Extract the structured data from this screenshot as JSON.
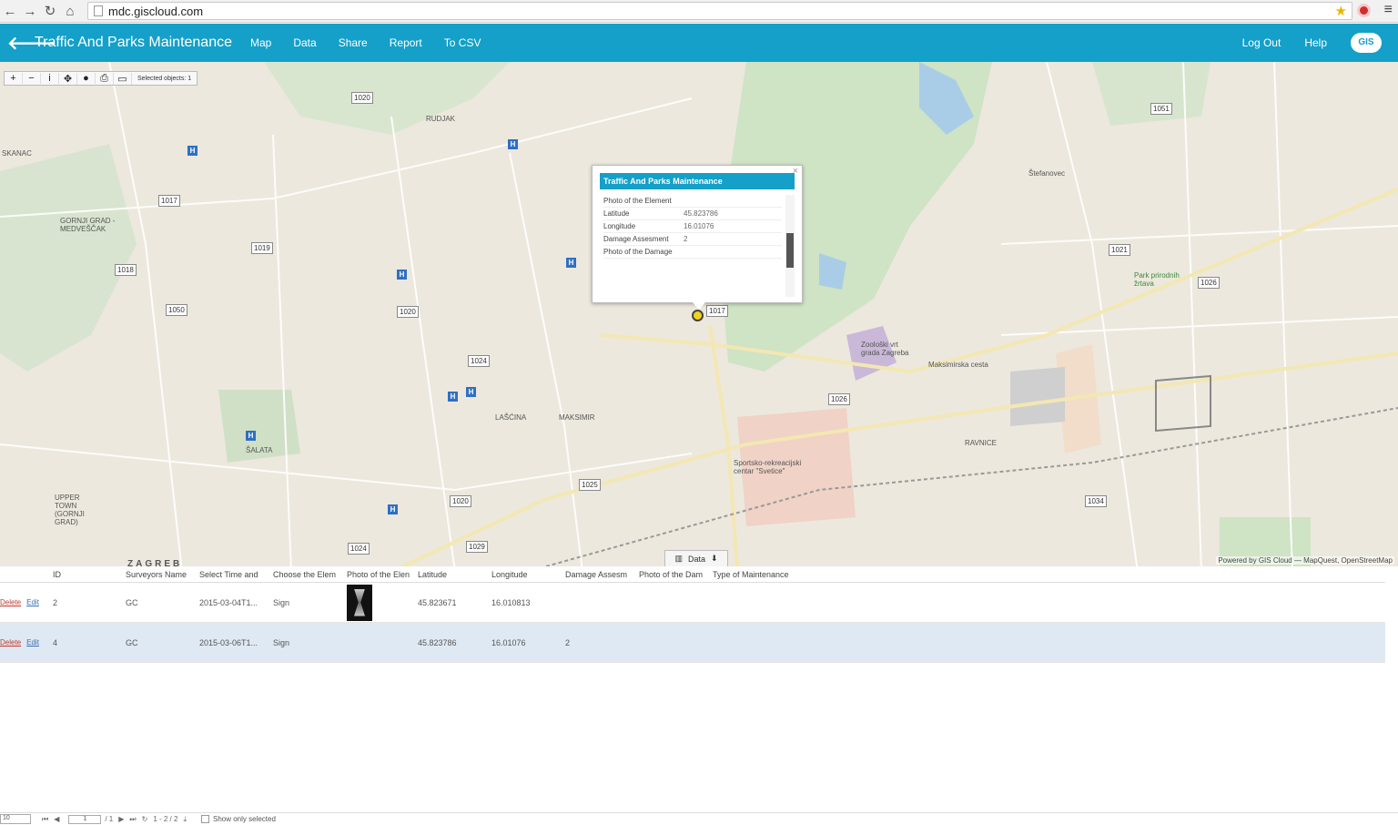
{
  "browser": {
    "url": "mdc.giscloud.com",
    "nav": {
      "back": "←",
      "forward": "→",
      "reload": "↻",
      "home": "⌂"
    },
    "icons": [
      "star-icon",
      "opera-icon",
      "menu-icon"
    ]
  },
  "header": {
    "title": "Traffic And Parks Maintenance",
    "menu": [
      "Map",
      "Data",
      "Share",
      "Report",
      "To CSV"
    ],
    "right_menu": [
      "Log Out",
      "Help"
    ],
    "logo_text": "GIS",
    "color": "#14a0c8"
  },
  "map": {
    "toolbar": {
      "tools": [
        "+",
        "−",
        "i",
        "✥",
        "●",
        "⎙",
        "▭"
      ],
      "selected_label": "Selected objects: 1"
    },
    "labels": [
      "SKANAC",
      "GORNJI GRAD - MEDVEŠČAK",
      "RUDJAK",
      "ŠALATA",
      "UPPER TOWN (GORNJI GRAD)",
      "LAŠĆINA",
      "MAKSIMIR",
      "RAVNICE",
      "ZAGREB",
      "Štefanovec",
      "Zoološki vrt grada Zagreba",
      "Sportsko-rekreacijski centar \"Svetice\"",
      "Park prirodnih žrtava",
      "Maksimirska cesta"
    ],
    "road_shields": [
      "1020",
      "1017",
      "1018",
      "1019",
      "1050",
      "1020",
      "1024",
      "1025",
      "1020",
      "1024",
      "1029",
      "1026",
      "1021",
      "1026",
      "1034",
      "1051",
      "1017"
    ],
    "attribution": "Powered by GIS Cloud — MapQuest, OpenStreetMap",
    "data_tab": "Data"
  },
  "popup": {
    "title": "Traffic And Parks Maintenance",
    "rows": [
      {
        "key": "Photo of the Element",
        "value": ""
      },
      {
        "key": "Latitude",
        "value": "45.823786"
      },
      {
        "key": "Longitude",
        "value": "16.01076"
      },
      {
        "key": "Damage Assesment",
        "value": "2"
      },
      {
        "key": "Photo of the Damage",
        "value": ""
      }
    ],
    "close": "×"
  },
  "table": {
    "columns": [
      "ID",
      "Surveyors Name",
      "Select Time and",
      "Choose the Elem",
      "Photo of the Elen",
      "Latitude",
      "Longitude",
      "Damage Assesm",
      "Photo of the Dam",
      "Type of Maintenance"
    ],
    "actions": {
      "delete": "Delete",
      "edit": "Edit"
    },
    "rows": [
      {
        "id": "2",
        "surveyor": "GC",
        "time": "2015-03-04T1...",
        "element": "Sign",
        "photo": true,
        "lat": "45.823671",
        "lng": "16.010813",
        "damage": "",
        "damage_photo": "",
        "type": ""
      },
      {
        "id": "4",
        "surveyor": "GC",
        "time": "2015-03-06T1...",
        "element": "Sign",
        "photo": false,
        "lat": "45.823786",
        "lng": "16.01076",
        "damage": "2",
        "damage_photo": "",
        "type": ""
      }
    ]
  },
  "pager": {
    "page_size": "10",
    "page": "1",
    "total_pages": "/ 1",
    "range": "1 - 2 / 2",
    "show_only_selected": "Show only selected"
  }
}
